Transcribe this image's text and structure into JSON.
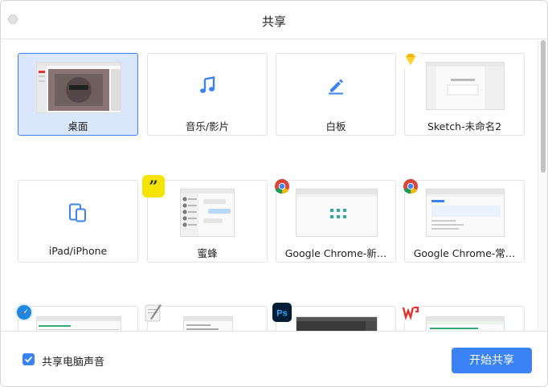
{
  "window": {
    "title": "共享"
  },
  "tiles": [
    {
      "label": "桌面",
      "kind": "desktop",
      "selected": true
    },
    {
      "label": "音乐/影片",
      "kind": "music-icon",
      "selected": false
    },
    {
      "label": "白板",
      "kind": "pencil-icon",
      "selected": false
    },
    {
      "label": "Sketch-未命名2",
      "kind": "sketch-window",
      "badge": "sketch-icon",
      "selected": false
    },
    {
      "label": "iPad/iPhone",
      "kind": "devices-icon",
      "selected": false
    },
    {
      "label": "蜜蜂",
      "kind": "chat-window",
      "badge": "quote-icon",
      "selected": false
    },
    {
      "label": "Google Chrome-新…",
      "kind": "chrome-window",
      "badge": "chrome-icon",
      "selected": false
    },
    {
      "label": "Google Chrome-常…",
      "kind": "chrome-window",
      "badge": "chrome-icon",
      "selected": false
    },
    {
      "label": "",
      "kind": "safari-window",
      "badge": "safari-icon",
      "selected": false
    },
    {
      "label": "",
      "kind": "textedit-window",
      "badge": "textedit-icon",
      "selected": false
    },
    {
      "label": "",
      "kind": "photoshop-window",
      "badge": "photoshop-icon",
      "selected": false
    },
    {
      "label": "",
      "kind": "wps-window",
      "badge": "wps-icon",
      "selected": false
    }
  ],
  "footer": {
    "share_audio_label": "共享电脑声音",
    "share_audio_checked": true,
    "start_button_label": "开始共享"
  },
  "colors": {
    "accent": "#3b82f6",
    "selected_bg": "#d9e6fb"
  }
}
